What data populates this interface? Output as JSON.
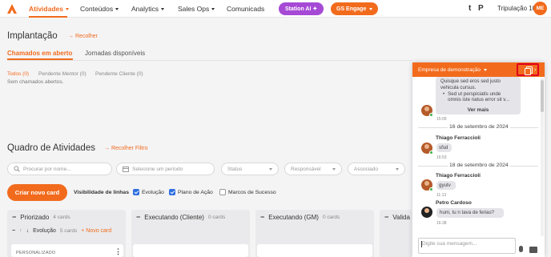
{
  "colors": {
    "accent": "#f26b1d",
    "station_ai": "#a64ad6",
    "highlight_border": "#e0001b",
    "checkbox_blue": "#2f6fe0"
  },
  "topnav": {
    "items": [
      {
        "label": "Atividades",
        "active": true,
        "caret": true
      },
      {
        "label": "Conteúdos",
        "caret": true
      },
      {
        "label": "Analytics",
        "caret": true
      },
      {
        "label": "Sales Ops",
        "caret": true
      },
      {
        "label": "Comunicads",
        "caret": false
      }
    ],
    "station_ai": "Station AI ✦",
    "gs_engage": "GS Engage",
    "icon_t": "t",
    "icon_p": "P",
    "tenant": "Tripulação 10x",
    "avatar_initials": "ME"
  },
  "implantacao": {
    "title": "Implantação",
    "collapse": "→ Recolher",
    "tabs": [
      "Chamados em aberto",
      "Jornadas disponíveis"
    ],
    "filters": [
      "Todos (0)",
      "Pendente Mentor (0)",
      "Pendente Cliente (0)"
    ],
    "empty": "Sem chamados abertos."
  },
  "quadro": {
    "title": "Quadro de Atividades",
    "collapse_filter": "→ Recolher Filtro",
    "search_placeholder": "Procurar por nome...",
    "period_placeholder": "Selecione um período",
    "status_placeholder": "Status",
    "responsible_placeholder": "Responsável",
    "associated_placeholder": "Associado",
    "create_button": "Criar novo card",
    "visibility_label": "Visibilidade de linhas",
    "checkboxes": [
      {
        "label": "Evolução",
        "checked": true
      },
      {
        "label": "Plano de Ação",
        "checked": true
      },
      {
        "label": "Marcos de Sucesso",
        "checked": false
      }
    ],
    "columns": [
      {
        "title": "Priorizado",
        "count": "4 cards"
      },
      {
        "title": "Executando (Cliente)",
        "count": "0 cards"
      },
      {
        "title": "Executando (GM)",
        "count": "0 cards"
      },
      {
        "title": "Valida",
        "count": ""
      }
    ],
    "row": {
      "title": "Evolução",
      "count": "5 cards",
      "add": "+ Novo card"
    },
    "card_label": "PERSONALIZADO"
  },
  "chat": {
    "company": "Empresa de demonstração",
    "msg1_lines": [
      "Quisque sed eros sed justo",
      "vehicula cursus."
    ],
    "msg1_bullet": [
      "Sed ut perspiciatis unde",
      "omnis iste natus error sit v..."
    ],
    "see_more": "Ver mais",
    "msg1_time": "15:09",
    "date1": "16 de setembro de 2024",
    "sender1": "Thiago Ferraccioli",
    "msg2": "sfsd",
    "msg2_time": "16:53",
    "date2": "18 de setembro de 2024",
    "sender2": "Thiago Ferraccioli",
    "msg3": "gyutv",
    "msg3_time": "11:13",
    "sender3": "Petro Cardoso",
    "msg4": "hum, tu n tava de ferias?",
    "msg4_time": "16:38",
    "input_placeholder": "Digite sua mensagem..."
  }
}
